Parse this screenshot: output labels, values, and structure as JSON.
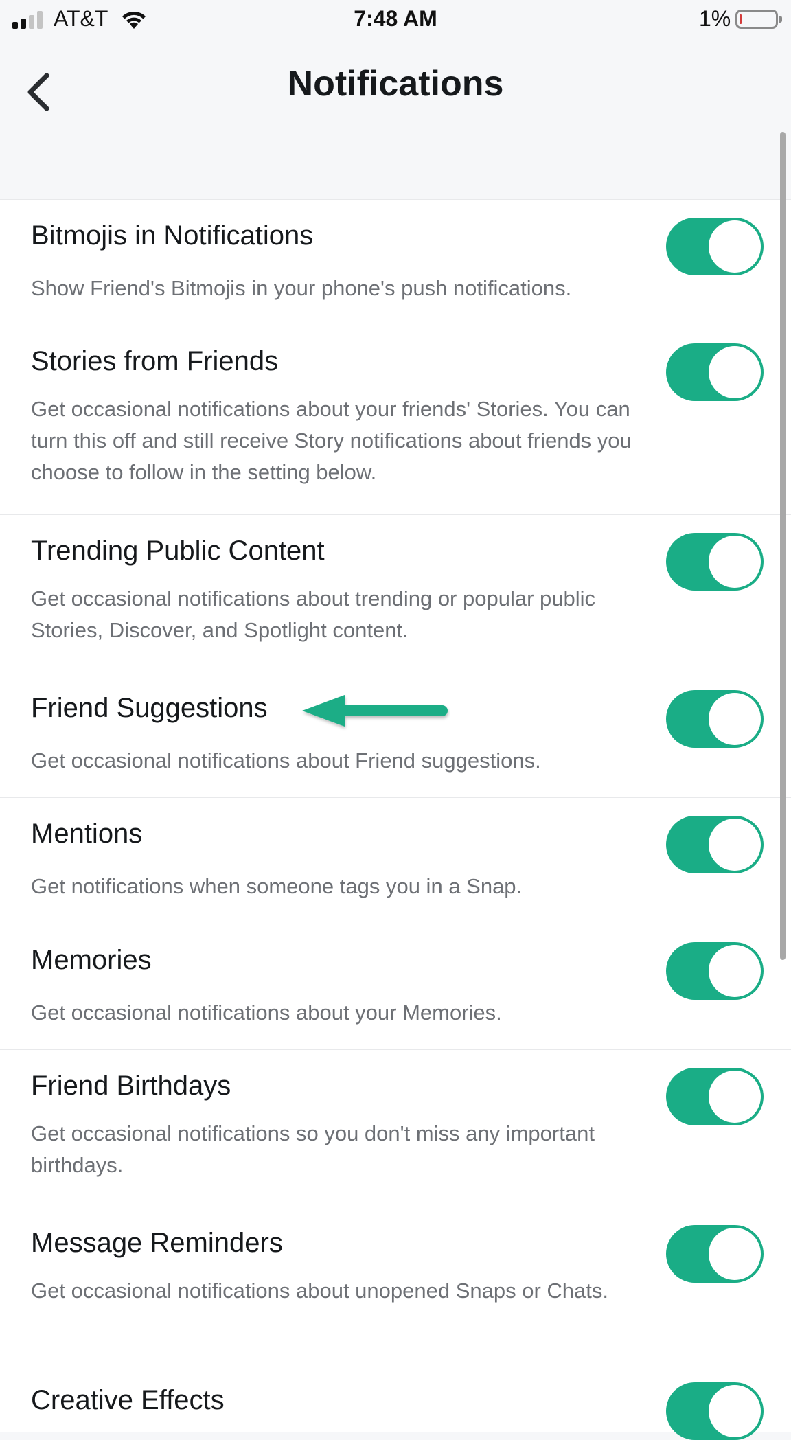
{
  "status_bar": {
    "carrier": "AT&T",
    "time": "7:48 AM",
    "battery_percent": "1%",
    "battery_level": 0.01,
    "signal_bars_active": 2,
    "signal_bars_total": 4,
    "icons": [
      "signal-icon",
      "wifi-icon",
      "battery-icon"
    ]
  },
  "header": {
    "title": "Notifications",
    "back_icon": "chevron-left-icon"
  },
  "colors": {
    "accent": "#1aad86",
    "background": "#f6f7f9",
    "row_background": "#ffffff",
    "title_text": "#16191c",
    "desc_text": "#6d7075",
    "battery_low": "#d43b3b"
  },
  "settings": [
    {
      "title": "Bitmojis in Notifications",
      "description": "Show Friend's Bitmojis in your phone's push notifications.",
      "enabled": true
    },
    {
      "title": "Stories from Friends",
      "description": "Get occasional notifications about your friends' Stories. You can turn this off and still receive Story notifications about friends you choose to follow in the setting below.",
      "enabled": true
    },
    {
      "title": "Trending Public Content",
      "description": "Get occasional notifications about trending or popular public Stories, Discover, and Spotlight content.",
      "enabled": true
    },
    {
      "title": "Friend Suggestions",
      "description": "Get occasional notifications about Friend suggestions.",
      "enabled": true,
      "highlighted": true
    },
    {
      "title": "Mentions",
      "description": "Get notifications when someone tags you in a Snap.",
      "enabled": true
    },
    {
      "title": "Memories",
      "description": "Get occasional notifications about your Memories.",
      "enabled": true
    },
    {
      "title": "Friend Birthdays",
      "description": "Get occasional notifications so you don't miss any important birthdays.",
      "enabled": true
    },
    {
      "title": "Message Reminders",
      "description": "Get occasional notifications about unopened Snaps or Chats.",
      "enabled": true
    },
    {
      "title": "Creative Effects",
      "description": "",
      "enabled": true
    }
  ],
  "annotation": {
    "type": "arrow",
    "points_to": "Friend Suggestions",
    "color": "#1aad86"
  }
}
